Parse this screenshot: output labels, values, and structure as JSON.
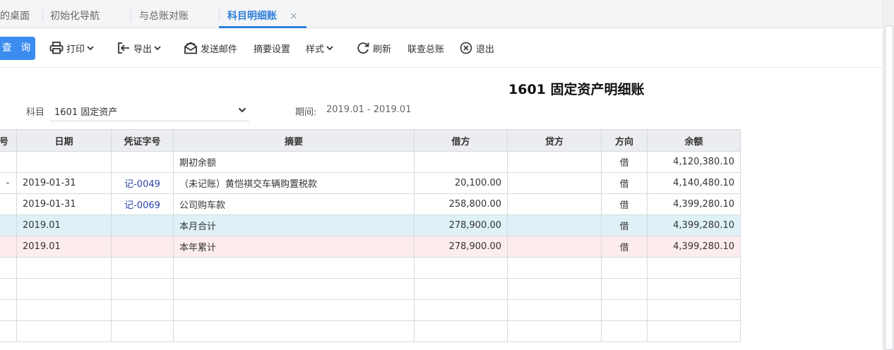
{
  "tabs": [
    {
      "label": "的桌面",
      "active": false
    },
    {
      "label": "初始化导航",
      "active": false
    },
    {
      "label": "与总账对账",
      "active": false
    },
    {
      "label": "科目明细账",
      "active": true
    }
  ],
  "tab_close_glyph": "×",
  "toolbar": {
    "query": "查 询",
    "print": "打印",
    "export": "导出",
    "send_email": "发送邮件",
    "summary_settings": "摘要设置",
    "style": "样式",
    "refresh": "刷新",
    "linked_ledger": "联查总账",
    "exit": "退出"
  },
  "report": {
    "title": "1601 固定资产明细账",
    "subject_label": "科目",
    "subject_value": "1601 固定资产",
    "period_label": "期间:",
    "period_value": "2019.01 - 2019.01"
  },
  "table": {
    "headers": {
      "seq": "号",
      "date": "日期",
      "voucher": "凭证字号",
      "summary": "摘要",
      "debit": "借方",
      "credit": "贷方",
      "direction": "方向",
      "balance": "余额"
    },
    "rows": [
      {
        "marker": "",
        "date": "",
        "voucher": "",
        "summary": "期初余额",
        "debit": "",
        "credit": "",
        "direction": "借",
        "balance": "4,120,380.10"
      },
      {
        "marker": "-",
        "date": "2019-01-31",
        "voucher": "记-0049",
        "summary": "（未记账）黄恺祺交车辆购置税款",
        "debit": "20,100.00",
        "credit": "",
        "direction": "借",
        "balance": "4,140,480.10"
      },
      {
        "marker": "",
        "date": "2019-01-31",
        "voucher": "记-0069",
        "summary": "公司购车款",
        "debit": "258,800.00",
        "credit": "",
        "direction": "借",
        "balance": "4,399,280.10"
      },
      {
        "marker": "",
        "date": "2019.01",
        "voucher": "",
        "summary": "本月合计",
        "debit": "278,900.00",
        "credit": "",
        "direction": "借",
        "balance": "4,399,280.10"
      },
      {
        "marker": "",
        "date": "2019.01",
        "voucher": "",
        "summary": "本年累计",
        "debit": "278,900.00",
        "credit": "",
        "direction": "借",
        "balance": "4,399,280.10"
      }
    ],
    "empty_rows": 5
  },
  "colors": {
    "accent": "#2f7ed8",
    "query_button": "#3c8cf0",
    "month_total_row": "#dff1f7",
    "year_total_row": "#fdecee",
    "voucher_link": "#2b45a8"
  },
  "icons": [
    "printer-icon",
    "export-icon",
    "email-icon",
    "refresh-icon",
    "exit-icon",
    "chevron-down-icon"
  ]
}
